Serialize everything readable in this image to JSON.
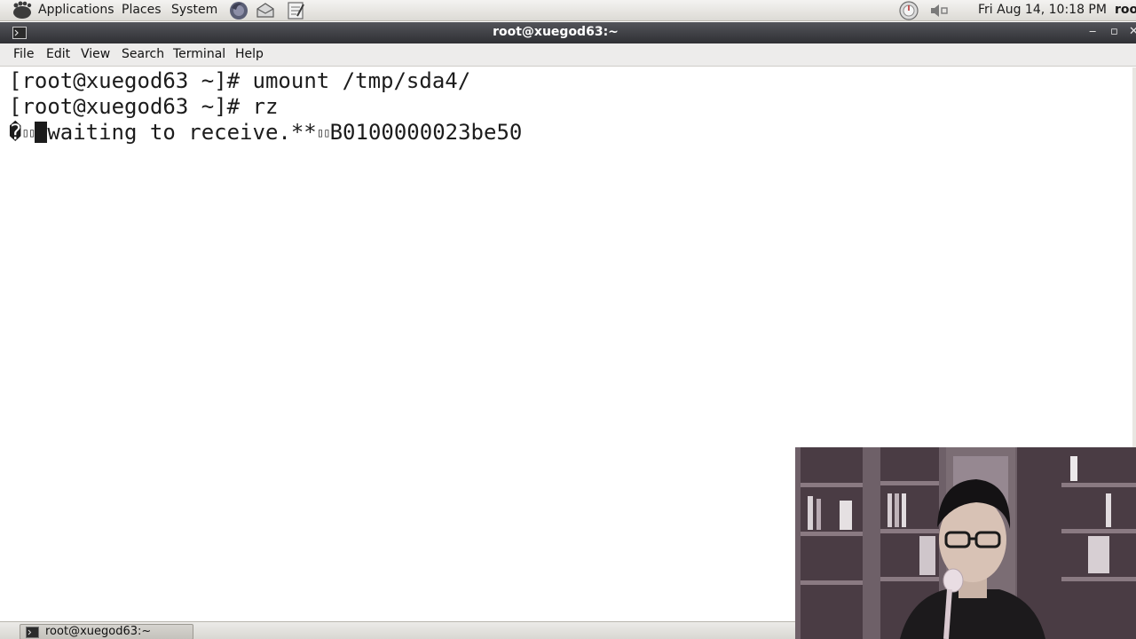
{
  "panel": {
    "menus": [
      "Applications",
      "Places",
      "System"
    ],
    "clock": "Fri Aug 14, 10:18 PM",
    "user": "roo",
    "launchers": [
      "firefox-icon",
      "mail-icon",
      "text-editor-icon"
    ]
  },
  "window": {
    "title": "root@xuegod63:~",
    "buttons": {
      "minimize": "‒",
      "maximize": "▫",
      "close": "✕"
    }
  },
  "menubar": {
    "items": [
      "File",
      "Edit",
      "View",
      "Search",
      "Terminal",
      "Help"
    ]
  },
  "terminal": {
    "lines": [
      "[root@xuegod63 ~]# umount /tmp/sda4/",
      "[root@xuegod63 ~]# rz"
    ],
    "rz_prefix": "�",
    "rz_text": "waiting to receive.**",
    "rz_hex": "B0100000023be50",
    "colors": {
      "background": "#ffffff",
      "foreground": "#1c1c1c"
    }
  },
  "taskbar": {
    "task_label": "root@xuegod63:~"
  },
  "colors": {
    "titlebar": "#3a3b40",
    "panel": "#e4e2dd"
  }
}
